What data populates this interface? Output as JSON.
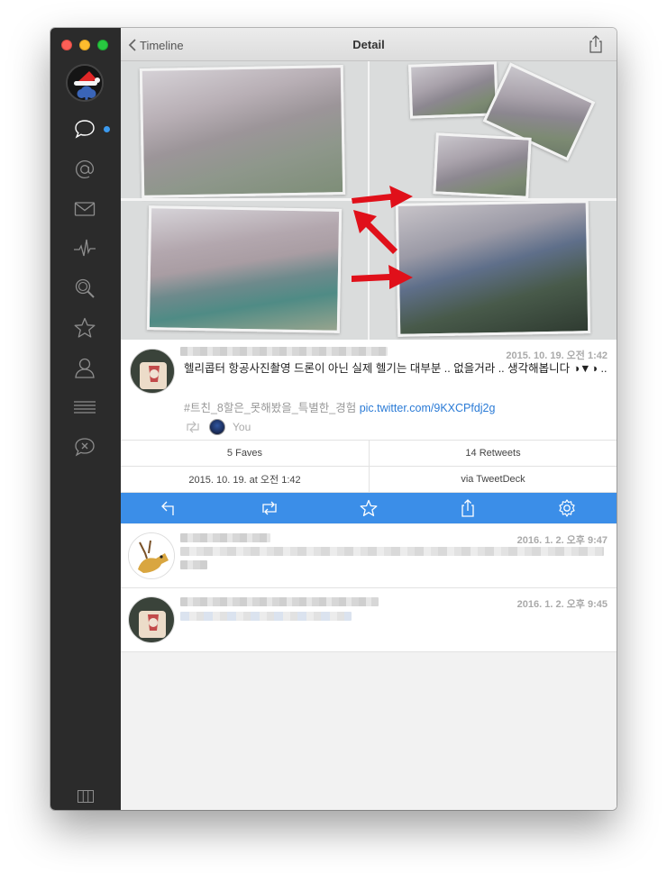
{
  "window": {
    "title": "Detail"
  },
  "header": {
    "back_label": "Timeline",
    "title": "Detail"
  },
  "sidebar": {
    "items": [
      {
        "name": "timeline",
        "icon": "speech-bubble-icon",
        "unread": true
      },
      {
        "name": "mentions",
        "icon": "at-sign-icon"
      },
      {
        "name": "messages",
        "icon": "envelope-icon"
      },
      {
        "name": "activity",
        "icon": "pulse-icon"
      },
      {
        "name": "search",
        "icon": "magnifier-icon"
      },
      {
        "name": "favorites",
        "icon": "star-icon"
      },
      {
        "name": "profile",
        "icon": "person-icon"
      },
      {
        "name": "lists",
        "icon": "list-icon"
      },
      {
        "name": "muted",
        "icon": "muted-bubble-icon"
      }
    ],
    "accent": "#3b9aee"
  },
  "tweet": {
    "date": "2015. 10. 19. 오전 1:42",
    "text": "헬리콥터 항공사진촬영 드론이 아닌 실제 헬기는 대부분 .. 없을거라 .. 생각해봅니다 ◑▼◑ ..",
    "hashtags": "#트친_8할은_못해봤을_특별한_경험",
    "link": "pic.twitter.com/9KXCPfdj2g",
    "retweeted_by": "You"
  },
  "stats": {
    "faves": "5 Faves",
    "retweets": "14 Retweets",
    "timestamp": "2015. 10. 19. at 오전 1:42",
    "via": "via TweetDeck"
  },
  "actions": {
    "color": "#3b8ee8",
    "items": [
      "reply-icon",
      "retweet-icon",
      "favorite-icon",
      "share-icon",
      "gear-icon"
    ]
  },
  "replies": [
    {
      "date": "2016. 1. 2. 오후 9:47"
    },
    {
      "date": "2016. 1. 2. 오후 9:45"
    }
  ],
  "colors": {
    "link": "#2b7bd6",
    "arrow": "#e0101a"
  }
}
